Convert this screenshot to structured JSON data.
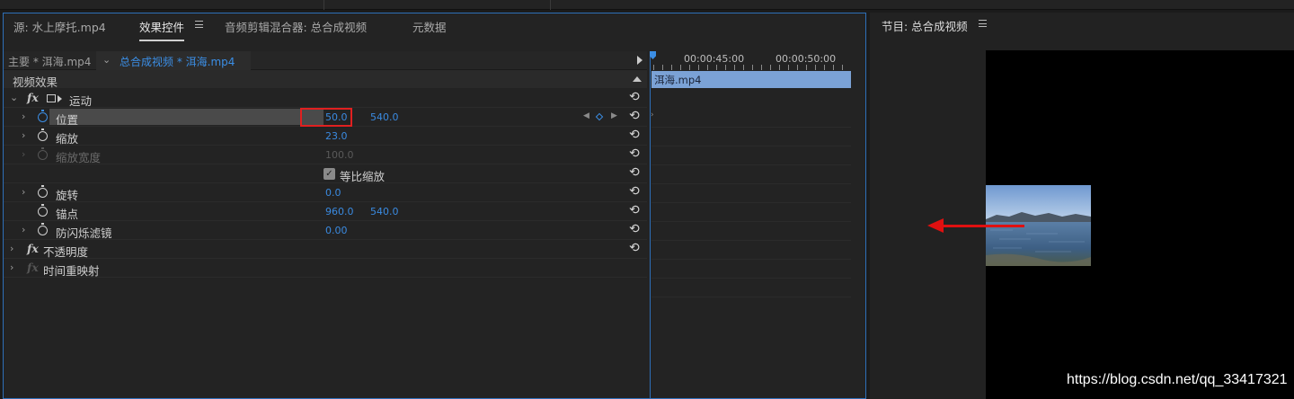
{
  "tabs": {
    "source": "源: 水上摩托.mp4",
    "effect_controls": "效果控件",
    "audio_mixer": "音频剪辑混合器: 总合成视频",
    "metadata": "元数据"
  },
  "clipbar": {
    "master": "主要 * 洱海.mp4",
    "sequence": "总合成视频 * 洱海.mp4"
  },
  "section": {
    "video_effects": "视频效果"
  },
  "effects": {
    "motion": "运动",
    "position": {
      "label": "位置",
      "x": "50.0",
      "y": "540.0"
    },
    "scale": {
      "label": "缩放",
      "value": "23.0"
    },
    "scale_width": {
      "label": "缩放宽度",
      "value": "100.0"
    },
    "uniform_scale": {
      "label": "等比缩放",
      "checked": true
    },
    "rotation": {
      "label": "旋转",
      "value": "0.0"
    },
    "anchor": {
      "label": "锚点",
      "x": "960.0",
      "y": "540.0"
    },
    "anti_flicker": {
      "label": "防闪烁滤镜",
      "value": "0.00"
    },
    "opacity": "不透明度",
    "time_remap": "时间重映射"
  },
  "timeline": {
    "time1": "00:00:45:00",
    "time2": "00:00:50:00",
    "clip_name": "洱海.mp4"
  },
  "program_monitor": {
    "title": "节目: 总合成视频"
  },
  "watermark": "https://blog.csdn.net/qq_33417321",
  "colors": {
    "accent_blue": "#3b8ee5",
    "highlight_red": "#e02020",
    "clip_blue": "#7ba2d6"
  }
}
